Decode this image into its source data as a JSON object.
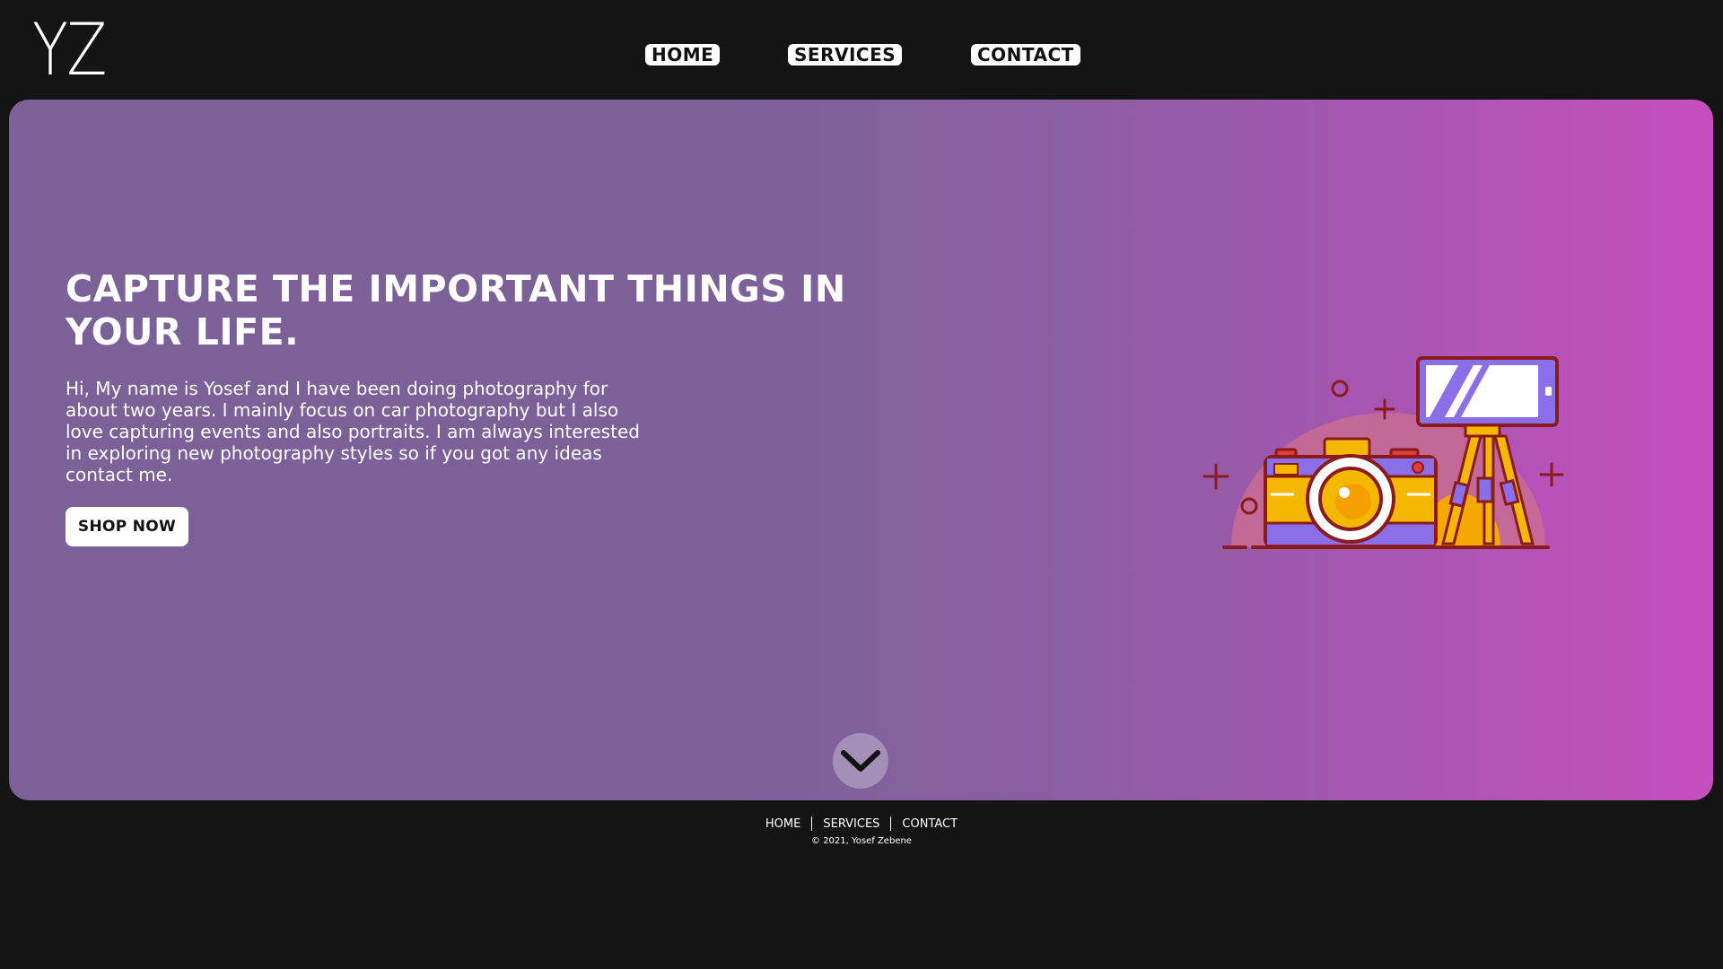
{
  "header": {
    "logo_text": "YZ",
    "nav": [
      {
        "label": "HOME"
      },
      {
        "label": "SERVICES"
      },
      {
        "label": "CONTACT"
      }
    ]
  },
  "hero": {
    "title": "CAPTURE THE IMPORTANT THINGS IN YOUR LIFE.",
    "description": "Hi, My name is Yosef and I have been doing photography for about two years. I mainly focus on car photography but I also love capturing events and also portraits. I am always interested in exploring new photography styles so if you got any ideas contact me.",
    "cta_label": "SHOP NOW",
    "illustration": "camera-and-tripod-illustration",
    "scroll_icon": "chevron-down-icon"
  },
  "footer": {
    "links": [
      {
        "label": "HOME"
      },
      {
        "label": "SERVICES"
      },
      {
        "label": "CONTACT"
      }
    ],
    "copyright": "© 2021, Yosef Zebene"
  },
  "colors": {
    "page_background": "#141414",
    "hero_gradient_start": "#7c6199",
    "hero_gradient_end": "#c54fbd",
    "camera_yellow": "#f5b800",
    "camera_purple": "#8a6fe8",
    "outline_red": "#8b1a1a"
  }
}
